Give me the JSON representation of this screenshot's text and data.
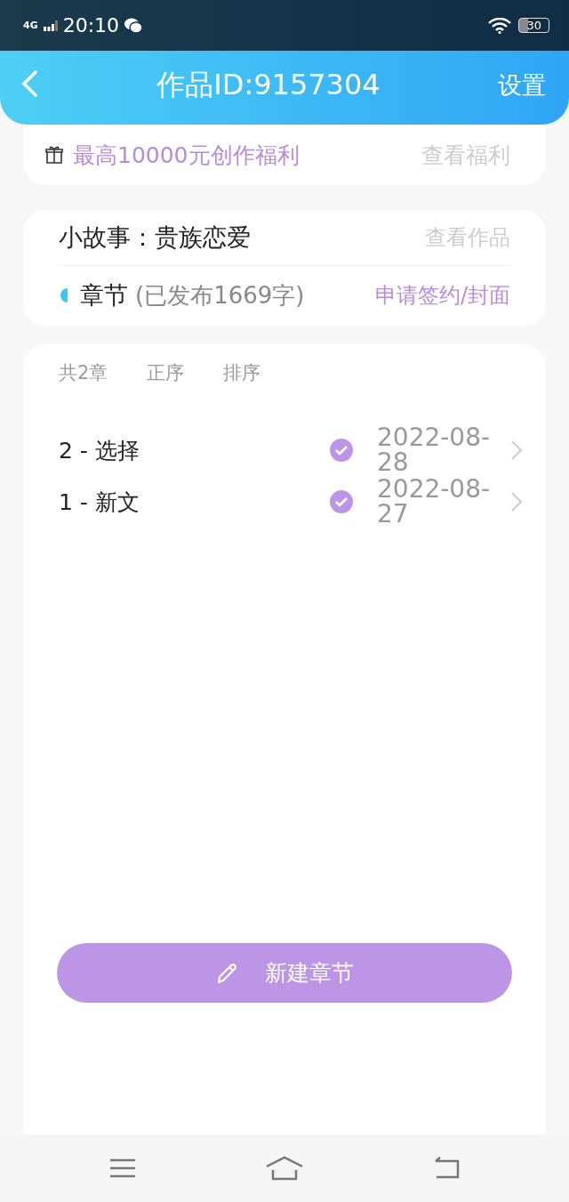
{
  "status_bar": {
    "network": "4G",
    "time": "20:10",
    "battery": "30"
  },
  "header": {
    "title": "作品ID:9157304",
    "action": "设置"
  },
  "welfare": {
    "text": "最高10000元创作福利",
    "link": "查看福利"
  },
  "work": {
    "title": "小故事：贵族恋爱",
    "link": "查看作品",
    "section": "章节",
    "published_note": "(已发布1669字)",
    "action": "申请签约/封面"
  },
  "chapters": {
    "count": "共2章",
    "order": "正序",
    "sort": "排序",
    "items": [
      {
        "title": "2 - 选择",
        "published": true,
        "date": "2022-08-28"
      },
      {
        "title": "1 - 新文",
        "published": true,
        "date": "2022-08-27"
      }
    ]
  },
  "new_button": "新建章节"
}
